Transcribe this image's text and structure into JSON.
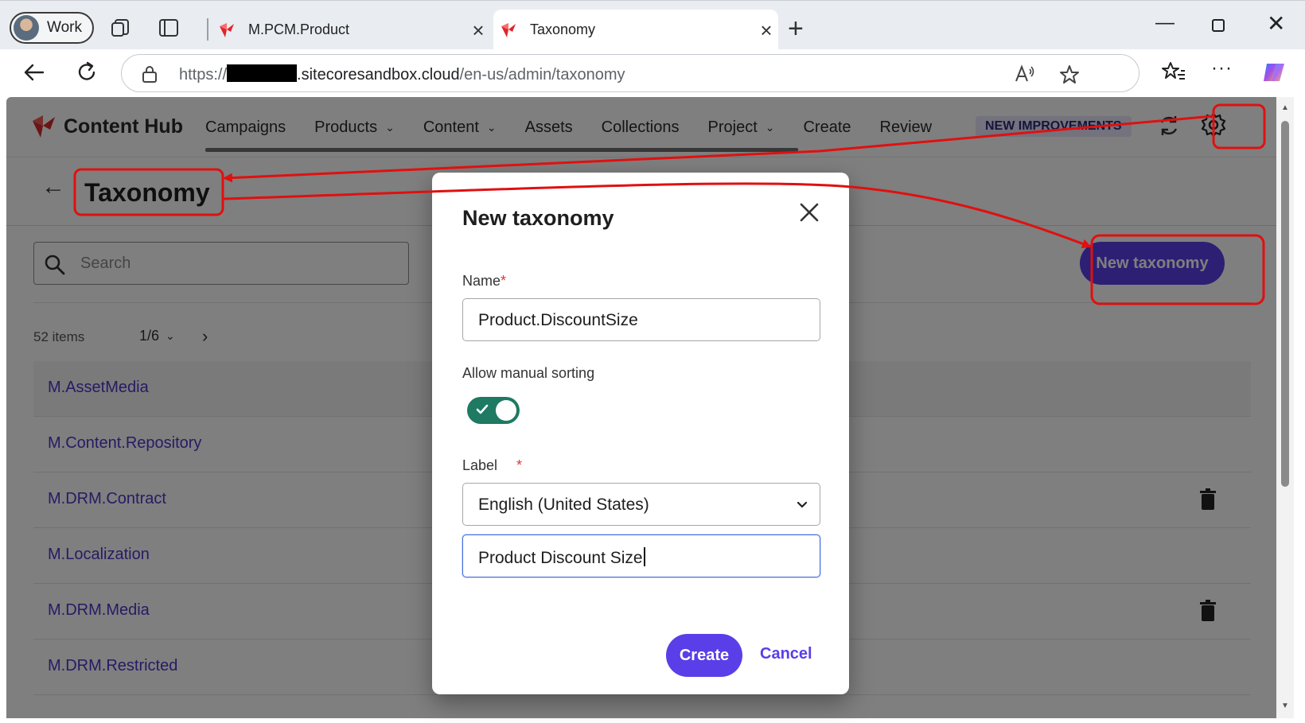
{
  "browser": {
    "profile_label": "Work",
    "tabs": [
      {
        "title": "M.PCM.Product",
        "active": false
      },
      {
        "title": "Taxonomy",
        "active": true
      }
    ],
    "url_prefix": "https://",
    "url_domain": ".sitecoresandbox.cloud",
    "url_path": "/en-us/admin/taxonomy"
  },
  "app": {
    "name": "Content Hub",
    "nav": [
      {
        "label": "Campaigns",
        "dropdown": false
      },
      {
        "label": "Products",
        "dropdown": true
      },
      {
        "label": "Content",
        "dropdown": true
      },
      {
        "label": "Assets",
        "dropdown": false
      },
      {
        "label": "Collections",
        "dropdown": false
      },
      {
        "label": "Project",
        "dropdown": true
      },
      {
        "label": "Create",
        "dropdown": false
      },
      {
        "label": "Review",
        "dropdown": false
      }
    ],
    "badge": "NEW IMPROVEMENTS"
  },
  "page": {
    "title": "Taxonomy",
    "search_placeholder": "Search",
    "new_button": "New taxonomy",
    "item_count": "52 items",
    "pager": "1/6",
    "rows": [
      {
        "name": "M.AssetMedia",
        "deletable": false
      },
      {
        "name": "M.Content.Repository",
        "deletable": false
      },
      {
        "name": "M.DRM.Contract",
        "deletable": true
      },
      {
        "name": "M.Localization",
        "deletable": false
      },
      {
        "name": "M.DRM.Media",
        "deletable": true
      },
      {
        "name": "M.DRM.Restricted",
        "deletable": false
      }
    ]
  },
  "modal": {
    "title": "New taxonomy",
    "name_label": "Name",
    "name_value": "Product.DiscountSize",
    "sorting_label": "Allow manual sorting",
    "sorting_enabled": true,
    "label_label": "Label",
    "required_mark": "*",
    "language_value": "English (United States)",
    "label_value": "Product Discount Size",
    "create_button": "Create",
    "cancel_button": "Cancel"
  },
  "colors": {
    "accent": "#5a3ee8",
    "link": "#4e36c9",
    "toggle_on": "#1e7a62",
    "annotation": "#e01010"
  }
}
